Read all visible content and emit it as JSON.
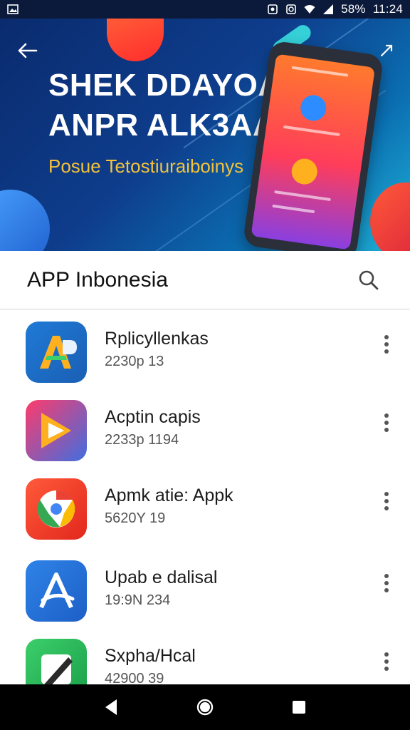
{
  "status_bar": {
    "battery": "58%",
    "time": "11:24",
    "icons": [
      "image-icon",
      "notification-icon",
      "sync-icon",
      "wifi-icon",
      "signal-icon"
    ]
  },
  "hero": {
    "title_line1": "SHEK DDAYOAL",
    "title_line2": "ANPR ALK3AA",
    "subtitle": "Posue Tetostiuraiboinys",
    "colors": {
      "title": "#ffffff",
      "subtitle": "#f3c23a"
    }
  },
  "app_bar": {
    "title": "APP Inbonesia"
  },
  "apps": [
    {
      "name": "Rplicyllenkas",
      "meta": "2230p 13",
      "icon": "letter-a-icon",
      "colors": [
        "#1f7ad6",
        "#1a5fb4"
      ]
    },
    {
      "name": "Acptin capis",
      "meta": "2233p 1194",
      "icon": "play-icon",
      "colors": [
        "#ff3b6b",
        "#3f6ee0"
      ]
    },
    {
      "name": "Apmk atie: Appk",
      "meta": "5620Y 19",
      "icon": "chrome-icon",
      "colors": [
        "#ff5a3a",
        "#e2271d"
      ]
    },
    {
      "name": "Upab e dalisal",
      "meta": "19:9N 234",
      "icon": "letter-a-outline-icon",
      "colors": [
        "#2e83e8",
        "#1d5fc6"
      ]
    },
    {
      "name": "Sxpha/Hcal",
      "meta": "42900 39",
      "icon": "pen-icon",
      "colors": [
        "#3ccf6b",
        "#1a9e49"
      ]
    }
  ],
  "nav_bar": {
    "buttons": [
      "back-icon",
      "home-icon",
      "recents-icon"
    ]
  }
}
